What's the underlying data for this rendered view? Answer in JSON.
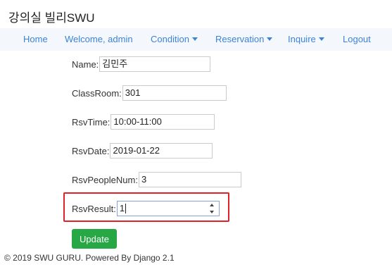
{
  "brand": "강의실 빌리SWU",
  "nav": {
    "home": "Home",
    "welcome": "Welcome, admin",
    "condition": "Condition",
    "reservation": "Reservation",
    "inquire": "Inquire",
    "logout": "Logout"
  },
  "form": {
    "name": {
      "label": "Name:",
      "value": "김민주"
    },
    "classroom": {
      "label": "ClassRoom:",
      "value": "301"
    },
    "rsvtime": {
      "label": "RsvTime:",
      "value": "10:00-11:00"
    },
    "rsvdate": {
      "label": "RsvDate:",
      "value": "2019-01-22"
    },
    "rsvpeoplenum": {
      "label": "RsvPeopleNum:",
      "value": "3"
    },
    "rsvresult": {
      "label": "RsvResult:",
      "value": "1"
    },
    "submit": "Update"
  },
  "footer": "© 2019 SWU GURU. Powered By Django 2.1",
  "colors": {
    "nav_link": "#3d82d6",
    "button": "#28a745",
    "highlight": "#e0202a"
  }
}
